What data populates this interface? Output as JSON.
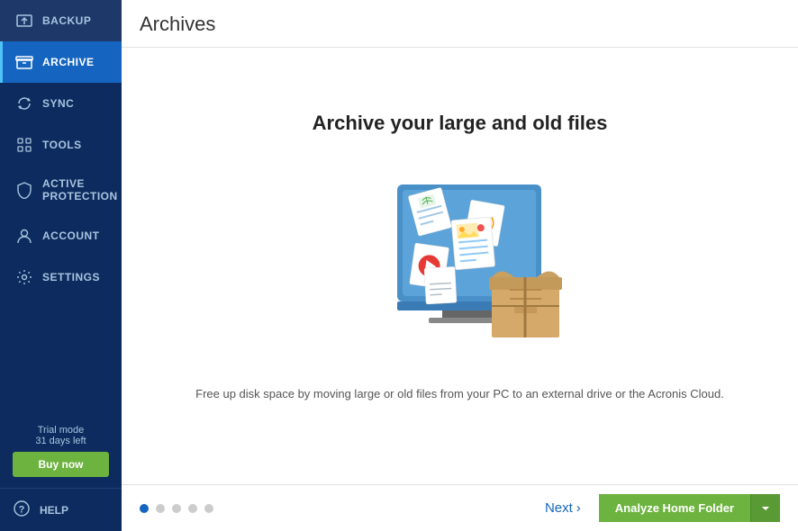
{
  "sidebar": {
    "items": [
      {
        "id": "backup",
        "label": "BACKUP",
        "icon": "backup-icon",
        "active": false
      },
      {
        "id": "archive",
        "label": "ARCHIVE",
        "icon": "archive-icon",
        "active": true
      },
      {
        "id": "sync",
        "label": "SYNC",
        "icon": "sync-icon",
        "active": false
      },
      {
        "id": "tools",
        "label": "TOOLS",
        "icon": "tools-icon",
        "active": false
      },
      {
        "id": "active-protection",
        "label": "ACTIVE PROTECTION",
        "icon": "shield-icon",
        "active": false
      },
      {
        "id": "account",
        "label": "ACCOUNT",
        "icon": "account-icon",
        "active": false
      },
      {
        "id": "settings",
        "label": "SETTINGS",
        "icon": "settings-icon",
        "active": false
      }
    ],
    "trial": {
      "line1": "Trial mode",
      "line2": "31 days left"
    },
    "buy_now_label": "Buy now",
    "help_label": "HELP"
  },
  "header": {
    "title": "Archives"
  },
  "main": {
    "hero_title": "Archive your large and old files",
    "description": "Free up disk space by moving large or old files from your PC to an external drive or the Acronis Cloud.",
    "dots": [
      {
        "active": true
      },
      {
        "active": false
      },
      {
        "active": false
      },
      {
        "active": false
      },
      {
        "active": false
      }
    ],
    "next_label": "Next",
    "analyze_label": "Analyze Home Folder"
  },
  "colors": {
    "sidebar_bg": "#0d2b5e",
    "active_bg": "#1565c0",
    "accent": "#4fc3f7",
    "green": "#6db33f",
    "text_primary": "#222",
    "text_secondary": "#555",
    "link_color": "#1565c0"
  }
}
